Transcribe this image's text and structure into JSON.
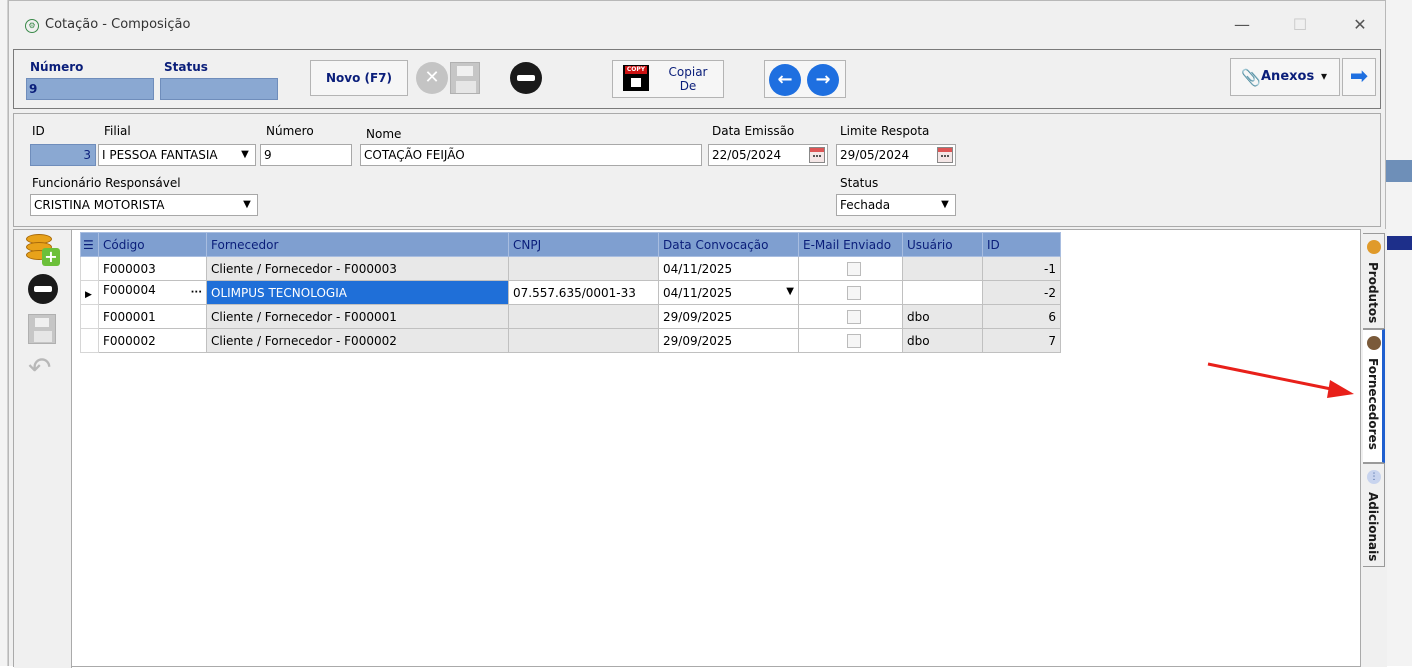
{
  "window": {
    "title": "Cotação - Composição",
    "min_glyph": "—",
    "max_glyph": "☐",
    "close_glyph": "✕"
  },
  "toolbar": {
    "numero_label": "Número",
    "numero_value": "9",
    "status_label": "Status",
    "status_value": "",
    "novo_label": "Novo (F7)",
    "copy_badge": "COPY",
    "copiar_line1": "Copiar",
    "copiar_line2": "De",
    "anexos_label": "Anexos",
    "anexos_caret": "▾",
    "prev_icon": "arrow-left-icon",
    "next_icon": "arrow-right-icon",
    "exit_glyph": "➡"
  },
  "form": {
    "id_label": "ID",
    "id_value": "3",
    "filial_label": "Filial",
    "filial_value": "I PESSOA FANTASIA",
    "numero_label": "Número",
    "numero_value": "9",
    "nome_label": "Nome",
    "nome_value": "COTAÇÃO FEIJÃO",
    "data_emissao_label": "Data Emissão",
    "data_emissao_value": "22/05/2024",
    "limite_label": "Limite Respota",
    "limite_value": "29/05/2024",
    "funcionario_label": "Funcionário Responsável",
    "funcionario_value": "CRISTINA MOTORISTA",
    "status_label": "Status",
    "status_value": "Fechada"
  },
  "grid": {
    "headers": [
      "Código",
      "Fornecedor",
      "CNPJ",
      "Data Convocação",
      "E-Mail Enviado",
      "Usuário",
      "ID"
    ],
    "rows": [
      {
        "codigo": "F000003",
        "fornecedor": "Cliente / Fornecedor - F000003",
        "cnpj": "",
        "data": "04/11/2025",
        "email": false,
        "usuario": "",
        "id": "-1"
      },
      {
        "codigo": "F000004",
        "fornecedor": "OLIMPUS TECNOLOGIA",
        "cnpj": "07.557.635/0001-33",
        "data": "04/11/2025",
        "email": false,
        "usuario": "",
        "id": "-2"
      },
      {
        "codigo": "F000001",
        "fornecedor": "Cliente / Fornecedor - F000001",
        "cnpj": "",
        "data": "29/09/2025",
        "email": false,
        "usuario": "dbo",
        "id": "6"
      },
      {
        "codigo": "F000002",
        "fornecedor": "Cliente / Fornecedor - F000002",
        "cnpj": "",
        "data": "29/09/2025",
        "email": false,
        "usuario": "dbo",
        "id": "7"
      }
    ],
    "selected_row": 1
  },
  "tabs": {
    "produtos": "Produtos",
    "fornecedores": "Fornecedores",
    "adicionais": "Adicionais",
    "active": "Fornecedores"
  },
  "colors": {
    "accent_blue": "#1f6fd8",
    "header_blue": "#7f9fd0",
    "label_navy": "#0a1e7a",
    "annotation_red": "#e8201a"
  }
}
